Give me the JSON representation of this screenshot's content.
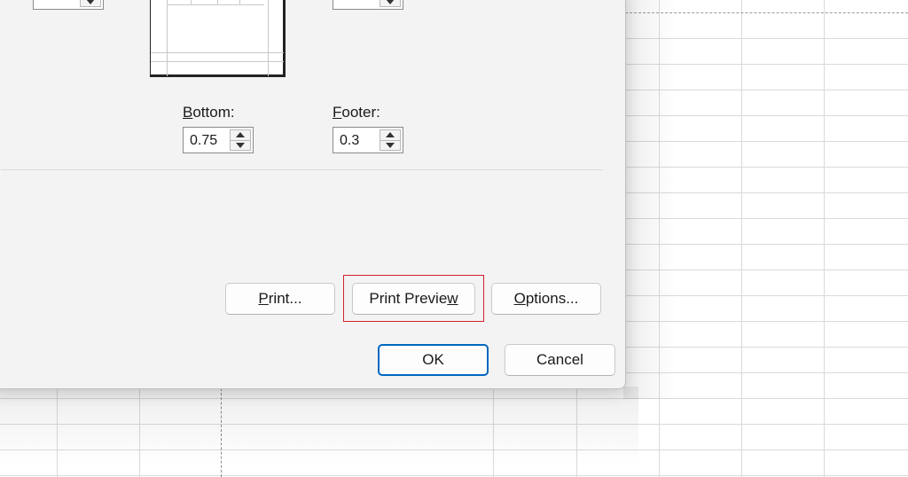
{
  "dialog": {
    "bottom_label_pre": "",
    "bottom_label_accel": "B",
    "bottom_label_post": "ottom:",
    "bottom_value": "0.75",
    "footer_label_accel": "F",
    "footer_label_post": "ooter:",
    "footer_value": "0.3",
    "buttons": {
      "print_accel": "P",
      "print_post": "rint...",
      "preview_pre": "Print Previe",
      "preview_accel": "w",
      "options_accel": "O",
      "options_post": "ptions...",
      "ok": "OK",
      "cancel": "Cancel"
    }
  },
  "colors": {
    "highlight": "#d0202a",
    "ok_border": "#0067c0"
  }
}
